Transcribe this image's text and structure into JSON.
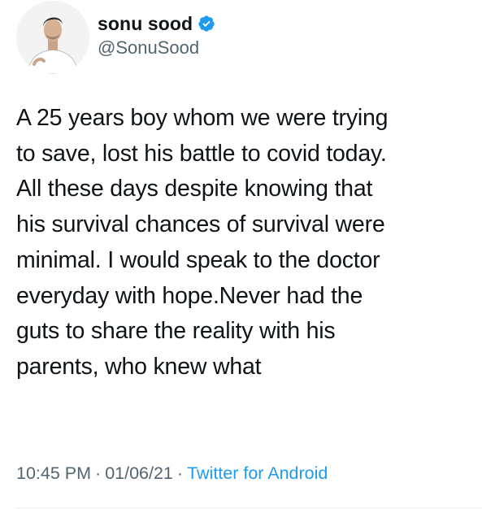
{
  "author": {
    "display_name": "sonu sood",
    "handle": "@SonuSood",
    "verified": true,
    "avatar_icon": "profile-photo"
  },
  "tweet": {
    "lines": [
      "A 25 years boy whom we were trying",
      "to save,  lost his battle to covid today.",
      "All these days despite knowing that",
      "his survival chances of survival were",
      "minimal. I would  speak to the doctor",
      "everyday with hope.Never had the",
      "guts to share the reality with his",
      "parents, who knew what"
    ]
  },
  "meta": {
    "time": "10:45 PM",
    "date": "01/06/21",
    "separator": "·",
    "source": "Twitter for Android"
  },
  "colors": {
    "text": "#0f1419",
    "secondary": "#536471",
    "accent": "#1d9bf0"
  }
}
